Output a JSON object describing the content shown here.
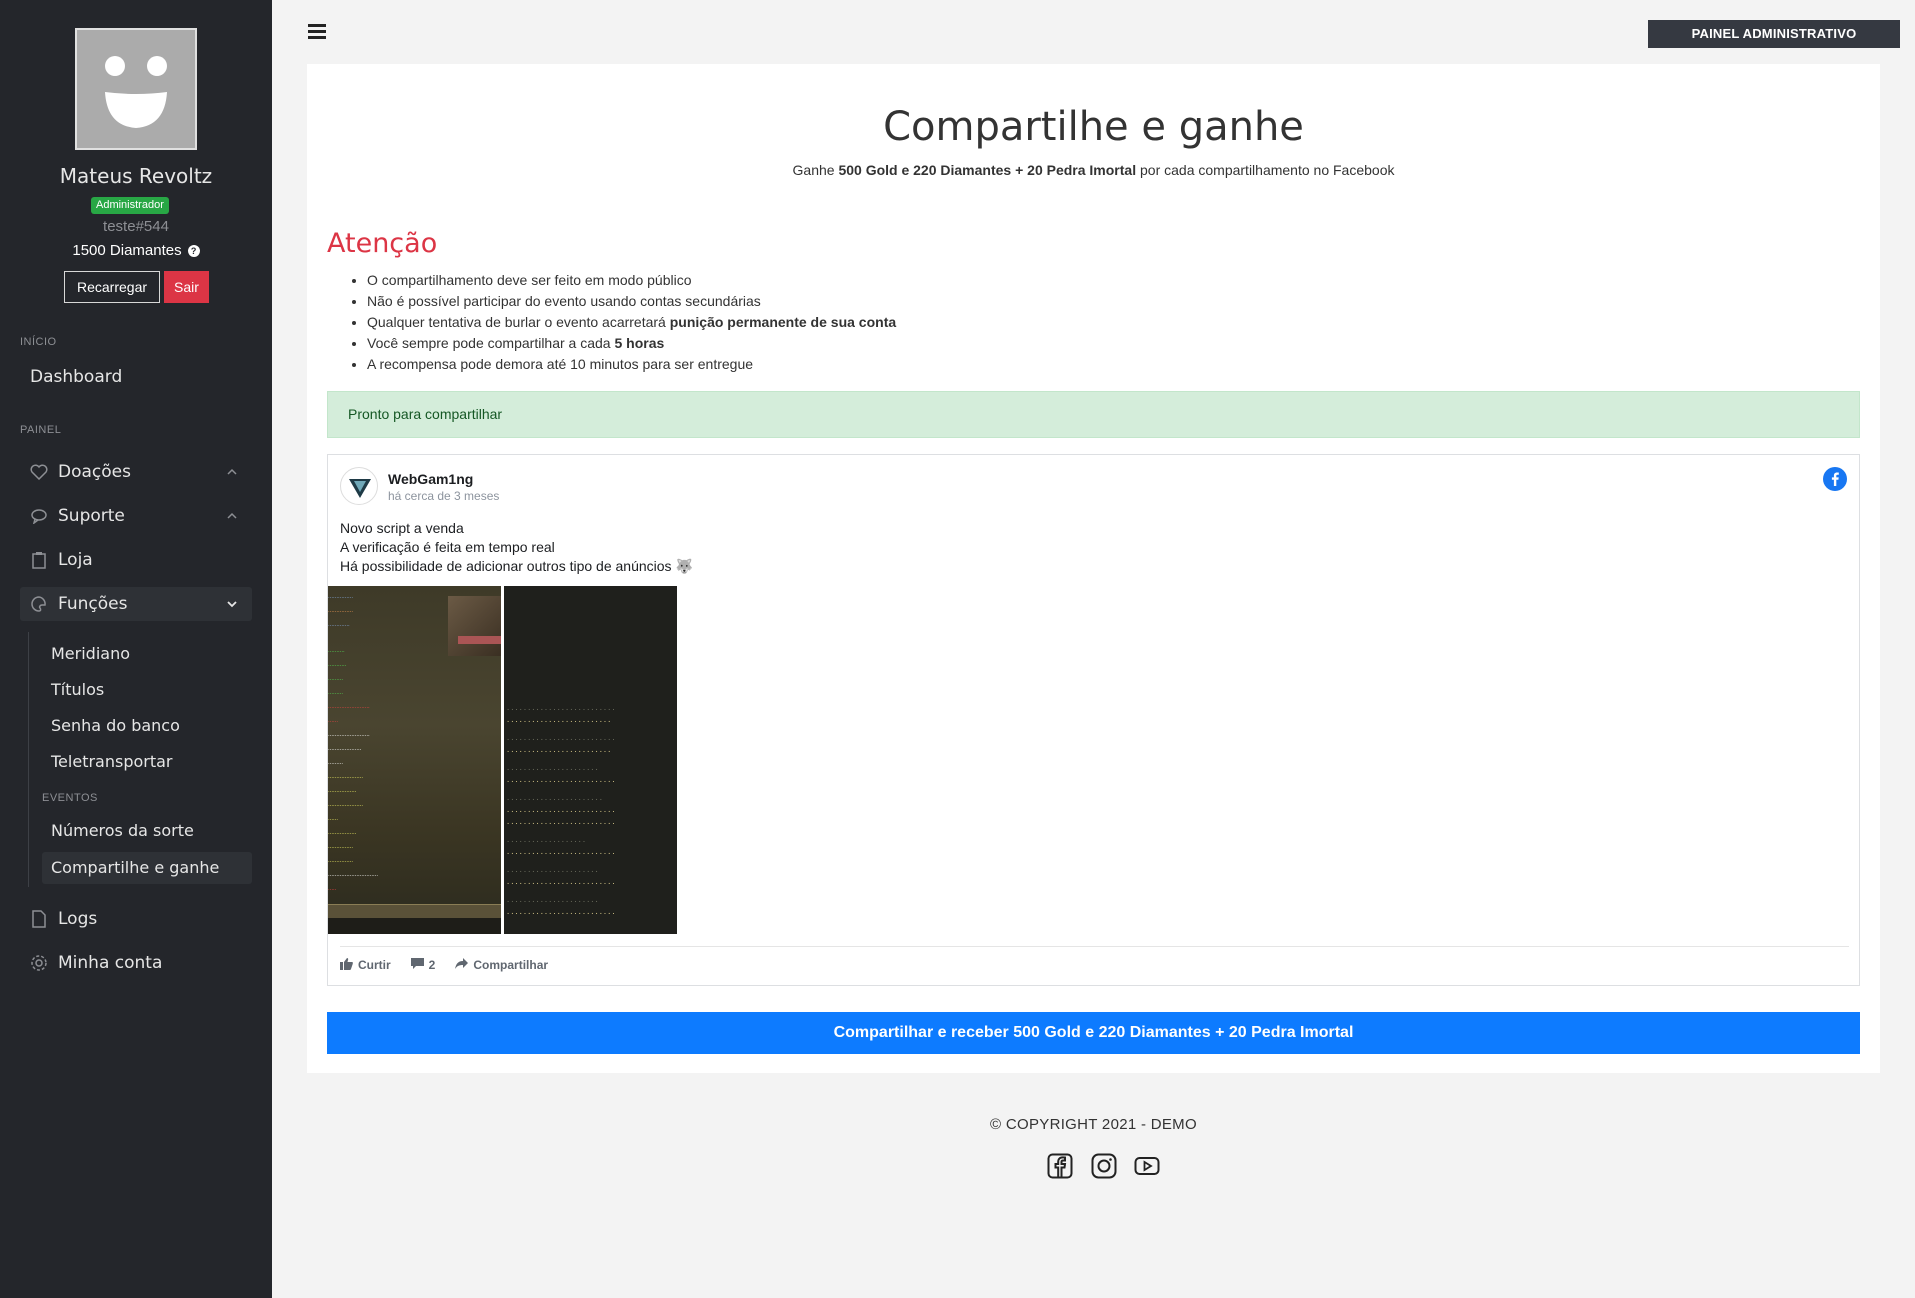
{
  "sidebar": {
    "profile": {
      "name": "Mateus Revoltz",
      "role": "Administrador",
      "tag": "teste#544",
      "diamonds": "1500 Diamantes",
      "reload_label": "Recarregar",
      "logout_label": "Sair"
    },
    "section_inicio": "INÍCIO",
    "dashboard": "Dashboard",
    "section_painel": "PAINEL",
    "items": {
      "doacoes": "Doações",
      "suporte": "Suporte",
      "loja": "Loja",
      "funcoes": "Funções",
      "logs": "Logs",
      "minha_conta": "Minha conta"
    },
    "funcoes_sub": [
      "Meridiano",
      "Títulos",
      "Senha do banco",
      "Teletransportar"
    ],
    "section_eventos": "EVENTOS",
    "eventos_sub": [
      "Números da sorte",
      "Compartilhe e ganhe"
    ]
  },
  "topbar": {
    "admin_button": "PAINEL ADMINISTRATIVO"
  },
  "main": {
    "title": "Compartilhe e ganhe",
    "subtitle_prefix": "Ganhe ",
    "subtitle_reward": "500 Gold e 220 Diamantes + 20 Pedra Imortal",
    "subtitle_suffix": " por cada compartilhamento no Facebook",
    "attention_title": "Atenção",
    "rules": [
      {
        "text": "O compartilhamento deve ser feito em modo público",
        "bold": ""
      },
      {
        "text": "Não é possível participar do evento usando contas secundárias",
        "bold": ""
      },
      {
        "text": "Qualquer tentativa de burlar o evento acarretará ",
        "bold": "punição permanente de sua conta"
      },
      {
        "text": "Você sempre pode compartilhar a cada ",
        "bold": "5 horas"
      },
      {
        "text": "A recompensa pode demora até 10 minutos para ser entregue",
        "bold": ""
      }
    ],
    "alert": "Pronto para compartilhar",
    "post": {
      "author": "WebGam1ng",
      "time": "há cerca de 3 meses",
      "lines": [
        "Novo script a venda",
        "A verificação é feita em tempo real",
        "Há possibilidade de adicionar outros tipo de anúncios 🐺"
      ],
      "like_label": "Curtir",
      "comments_count": "2",
      "share_label": "Compartilhar"
    },
    "share_button": "Compartilhar e receber 500 Gold e 220 Diamantes + 20 Pedra Imortal"
  },
  "footer": {
    "copyright": "© COPYRIGHT 2021 - DEMO",
    "social_icons": [
      "facebook-icon",
      "instagram-icon",
      "youtube-icon"
    ]
  },
  "colors": {
    "sidebar_bg": "#24262b",
    "badge_green": "#28a745",
    "danger_red": "#dc3545",
    "primary_blue": "#0d7bff",
    "alert_green_bg": "#d4edda",
    "facebook_blue": "#1877f2"
  }
}
